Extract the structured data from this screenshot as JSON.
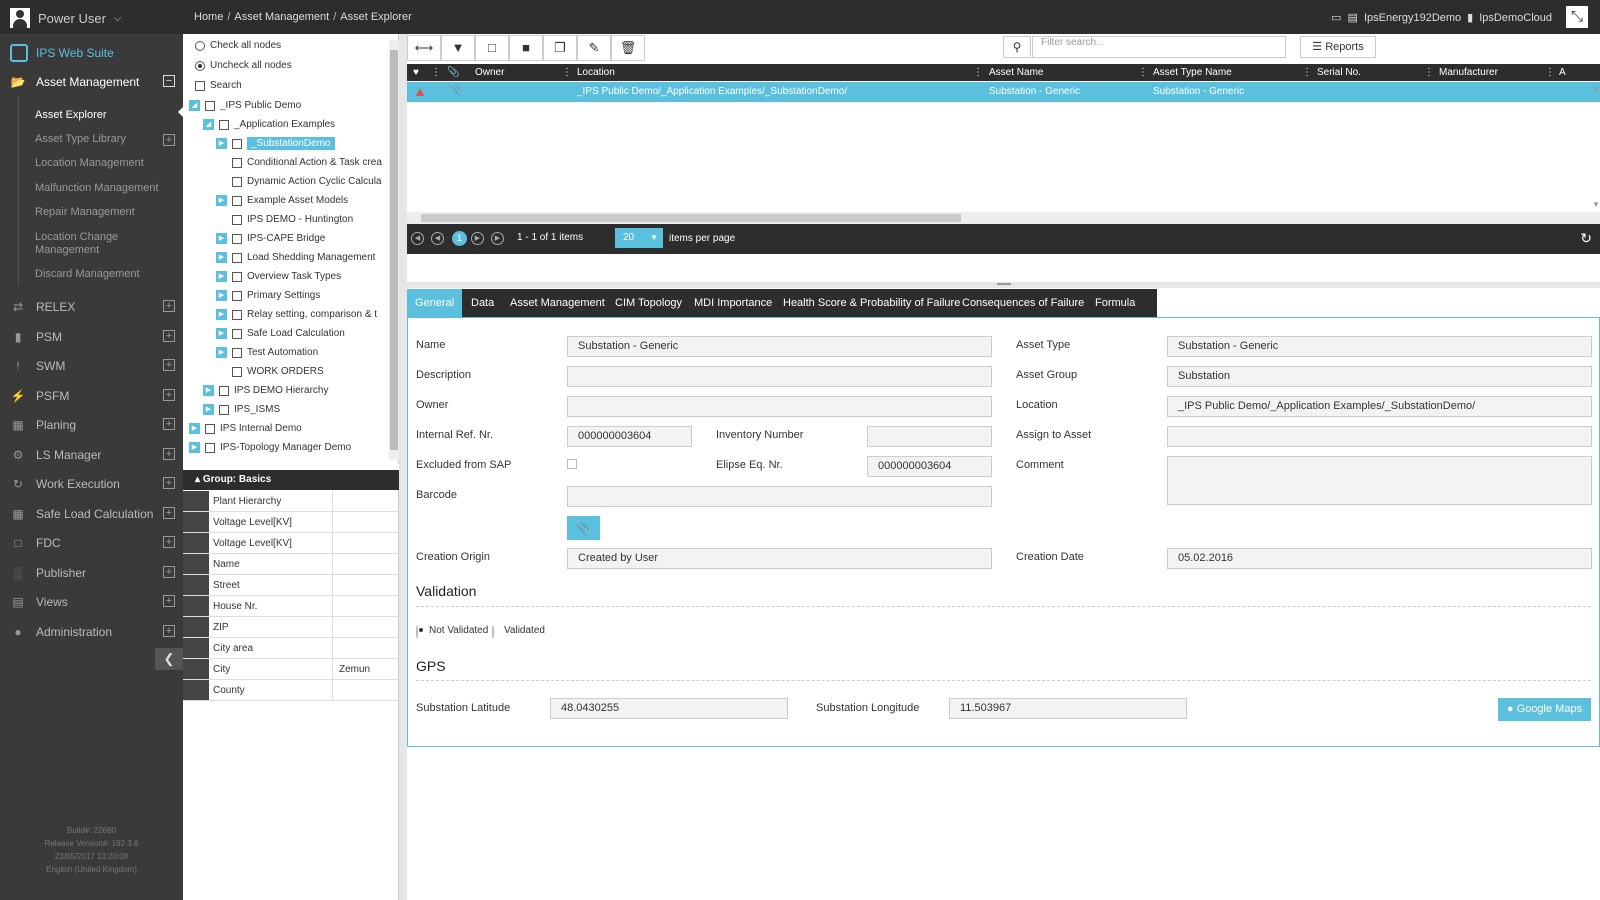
{
  "topbar": {
    "user": "Power User",
    "breadcrumb": [
      "Home",
      "Asset Management",
      "Asset Explorer"
    ],
    "server": "IpsEnergy192Demo",
    "cloud": "IpsDemoCloud"
  },
  "sidebar": {
    "brand": "IPS Web Suite",
    "section": "Asset Management",
    "sub_items": [
      "Asset Explorer",
      "Asset Type Library",
      "Location Management",
      "Malfunction Management",
      "Repair Management",
      "Location Change Management",
      "Discard Management"
    ],
    "items": [
      "RELEX",
      "PSM",
      "SWM",
      "PSFM",
      "Planing",
      "LS Manager",
      "Work Execution",
      "Safe Load Calculation",
      "FDC",
      "Publisher",
      "Views",
      "Administration"
    ],
    "build": [
      "Build#: 22680",
      "Release Version#: 192.3.6",
      "23/05/2017 13:20:08",
      "English (United Kingdom)"
    ]
  },
  "tree": {
    "check_all": "Check all nodes",
    "uncheck_all": "Uncheck all nodes",
    "search": "Search",
    "nodes": [
      "_IPS Public Demo",
      "_Application Examples",
      "_SubstationDemo",
      "Conditional Action & Task crea",
      "Dynamic Action Cyclic Calcula",
      "Example Asset Models",
      "IPS DEMO - Huntington",
      "IPS-CAPE Bridge",
      "Load Shedding Management",
      "Overview Task Types",
      "Primary Settings",
      "Relay setting, comparison & t",
      "Safe Load Calculation",
      "Test Automation",
      "WORK ORDERS",
      "IPS DEMO Hierarchy",
      "IPS_ISMS",
      "IPS Internal Demo",
      "IPS-Topology Manager Demo"
    ]
  },
  "group": {
    "title": "Group: Basics",
    "rows": [
      {
        "k": "Plant Hierarchy",
        "v": ""
      },
      {
        "k": "Voltage Level[KV]",
        "v": ""
      },
      {
        "k": "Voltage Level[KV]",
        "v": ""
      },
      {
        "k": "Name",
        "v": ""
      },
      {
        "k": "Street",
        "v": ""
      },
      {
        "k": "House Nr.",
        "v": ""
      },
      {
        "k": "ZIP",
        "v": ""
      },
      {
        "k": "City area",
        "v": ""
      },
      {
        "k": "City",
        "v": "Zemun"
      },
      {
        "k": "County",
        "v": ""
      }
    ]
  },
  "toolbar": {
    "search_placeholder": "Filter search...",
    "reports": "Reports"
  },
  "grid": {
    "columns": [
      "Owner",
      "Location",
      "Asset Name",
      "Asset Type Name",
      "Serial No.",
      "Manufacturer",
      "A"
    ],
    "row": {
      "location": "_IPS Public Demo/_Application Examples/_SubstationDemo/",
      "asset_name": "Substation - Generic",
      "asset_type": "Substation - Generic"
    },
    "pager": {
      "current": "1",
      "summary": "1 - 1 of 1 items",
      "per_page": "20",
      "per_page_label": "items per page"
    }
  },
  "tabs": [
    "General",
    "Data",
    "Asset Management",
    "CIM Topology",
    "MDI Importance",
    "Health Score & Probability of Failure",
    "Consequences of Failure",
    "Formula"
  ],
  "form": {
    "name_label": "Name",
    "name": "Substation - Generic",
    "desc_label": "Description",
    "owner_label": "Owner",
    "ref_label": "Internal Ref. Nr.",
    "ref": "000000003604",
    "inv_label": "Inventory Number",
    "sap_label": "Excluded from SAP",
    "elipse_label": "Elipse Eq. Nr.",
    "elipse": "000000003604",
    "barcode_label": "Barcode",
    "origin_label": "Creation Origin",
    "origin": "Created by User",
    "type_label": "Asset Type",
    "type": "Substation - Generic",
    "group_label": "Asset Group",
    "group": "Substation",
    "loc_label": "Location",
    "loc": "_IPS Public Demo/_Application Examples/_SubstationDemo/",
    "assign_label": "Assign to Asset",
    "comment_label": "Comment",
    "cdate_label": "Creation Date",
    "cdate": "05.02.2016",
    "validation_title": "Validation",
    "not_validated": "Not Validated",
    "validated": "Validated",
    "gps_title": "GPS",
    "lat_label": "Substation Latitude",
    "lat": "48.0430255",
    "lon_label": "Substation Longitude",
    "lon": "11.503967",
    "maps": "Google Maps"
  },
  "colors": {
    "accent": "#5bc0de",
    "dark": "#2d2d2d",
    "sidebar": "#3a3a3a"
  }
}
